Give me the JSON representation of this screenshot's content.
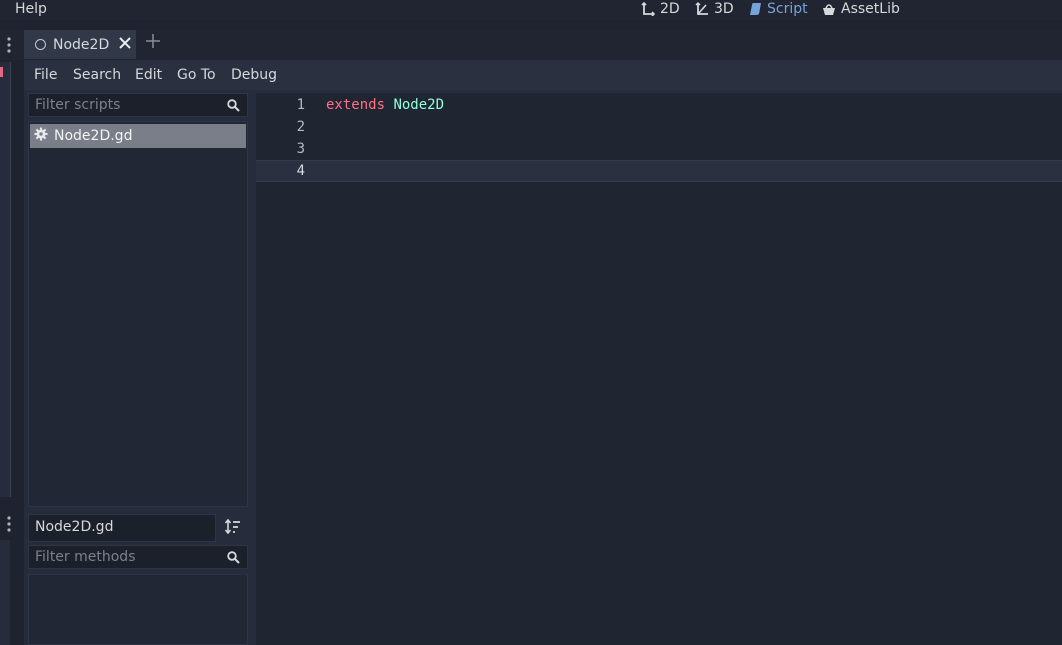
{
  "topbar": {
    "help_label": "Help",
    "workspaces": [
      {
        "label": "2D",
        "icon": "2d-axis-icon",
        "active": false
      },
      {
        "label": "3D",
        "icon": "3d-axis-icon",
        "active": false
      },
      {
        "label": "Script",
        "icon": "script-scroll-icon",
        "active": true
      },
      {
        "label": "AssetLib",
        "icon": "asset-basket-icon",
        "active": false
      }
    ]
  },
  "tabs": [
    {
      "label": "Node2D",
      "icon": "node2d-circle-icon",
      "closable": true
    }
  ],
  "script_menu": [
    "File",
    "Search",
    "Edit",
    "Go To",
    "Debug"
  ],
  "scripts": {
    "filter_placeholder": "Filter scripts",
    "items": [
      {
        "label": "Node2D.gd",
        "icon": "gear-icon",
        "selected": true
      }
    ]
  },
  "methods": {
    "current_script": "Node2D.gd",
    "filter_placeholder": "Filter methods"
  },
  "editor": {
    "line_numbers": [
      "1",
      "2",
      "3",
      "4"
    ],
    "current_line": "4",
    "line1_keyword": "extends",
    "line1_type": "Node2D"
  },
  "colors": {
    "accent": "#76a4d9",
    "keyword": "#ff7085",
    "type": "#8effda",
    "background": "#1f2330"
  }
}
